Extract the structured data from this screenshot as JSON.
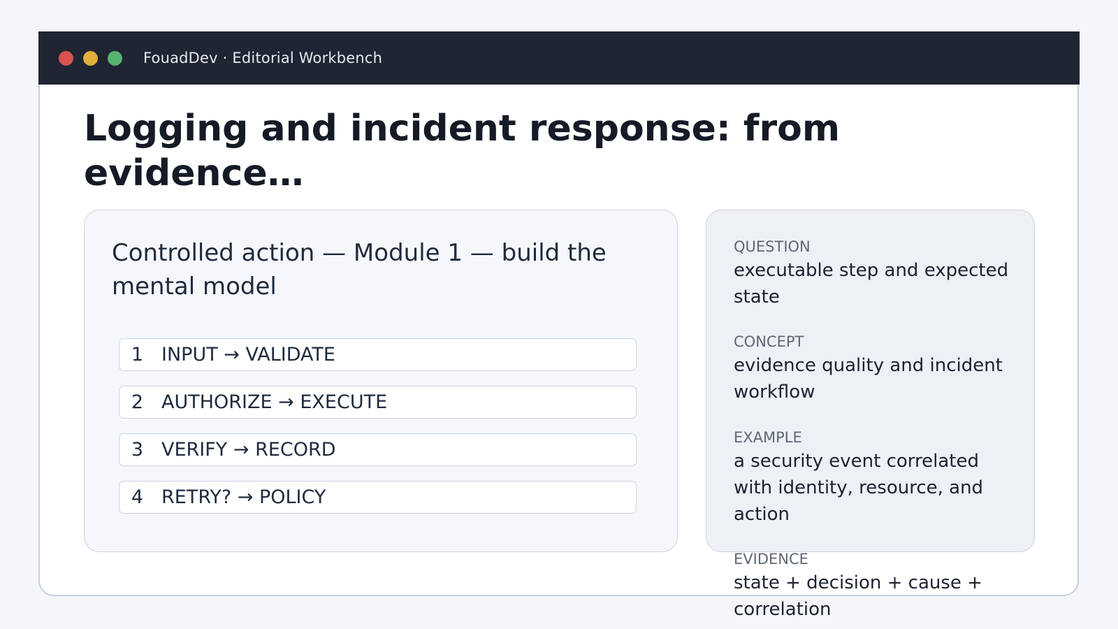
{
  "window": {
    "title": "FouadDev · Editorial Workbench",
    "controls": [
      {
        "name": "close",
        "color": "#d9534f"
      },
      {
        "name": "minimize",
        "color": "#e2b13c"
      },
      {
        "name": "maximize",
        "color": "#58b36e"
      }
    ]
  },
  "page": {
    "title": "Logging and incident response: from evidence…"
  },
  "module_card": {
    "heading": "Controlled action — Module 1 — build the mental model",
    "steps": [
      {
        "number": "1",
        "label": "INPUT → VALIDATE"
      },
      {
        "number": "2",
        "label": "AUTHORIZE → EXECUTE"
      },
      {
        "number": "3",
        "label": "VERIFY → RECORD"
      },
      {
        "number": "4",
        "label": "RETRY? → POLICY"
      }
    ]
  },
  "info_panel": {
    "items": [
      {
        "label": "QUESTION",
        "value": "executable step and expected state"
      },
      {
        "label": "CONCEPT",
        "value": "evidence quality and incident workflow"
      },
      {
        "label": "EXAMPLE",
        "value": "a security event correlated with identity, resource, and action"
      },
      {
        "label": "EVIDENCE",
        "value": "state + decision + cause + correlation"
      }
    ]
  },
  "colors": {
    "titlebar": "#1f2532",
    "background": "#f4f6fa",
    "text_primary": "#151b26",
    "text_muted": "#5f6775"
  }
}
